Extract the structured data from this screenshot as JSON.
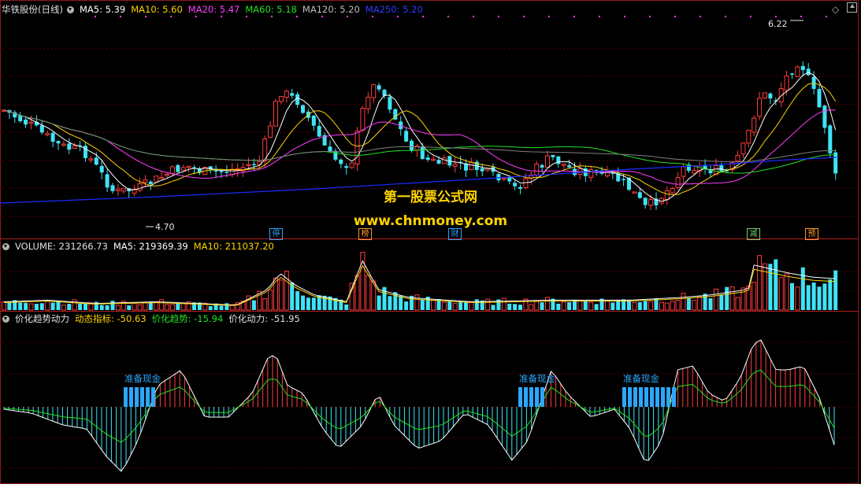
{
  "main_header": {
    "stock": "华铁股份(日线)",
    "ma5": "MA5: 5.39",
    "ma10": "MA10: 5.60",
    "ma20": "MA20: 5.47",
    "ma60": "MA60: 5.18",
    "ma120": "MA120: 5.20",
    "ma250": "MA250: 5.20"
  },
  "annotations": {
    "high": "6.22",
    "low": "4.70"
  },
  "watermark": {
    "line1": "第一股票公式网",
    "line2": "www.chnmoney.com"
  },
  "events": [
    {
      "char": "停",
      "color": "#2ba7ff"
    },
    {
      "char": "榜",
      "color": "#ff9a2e"
    },
    {
      "char": "财",
      "color": "#2ba7ff"
    },
    {
      "char": "减",
      "color": "#6fd46f"
    },
    {
      "char": "预",
      "color": "#ff9a2e"
    }
  ],
  "volume_header": {
    "volume": "VOLUME: 231266.73",
    "ma5": "MA5: 219369.39",
    "ma10": "MA10: 211037.20"
  },
  "indicator_header": {
    "name": "价化趋势动力",
    "dyn": "动态指标: -50.63",
    "trend": "价化趋势: -15.94",
    "power": "价化动力: -51.95"
  },
  "signals": [
    "准备现金",
    "准备现金",
    "准备现金"
  ],
  "colors": {
    "up": "#ff3d3d",
    "down": "#3fe3f6",
    "ma5": "#ffffff",
    "ma10": "#ffd400",
    "ma20": "#ff3dff",
    "ma60": "#21e321",
    "ma120": "#7f7f7f",
    "ma250": "#1c2cff",
    "signal": "#2ba7ff"
  }
}
